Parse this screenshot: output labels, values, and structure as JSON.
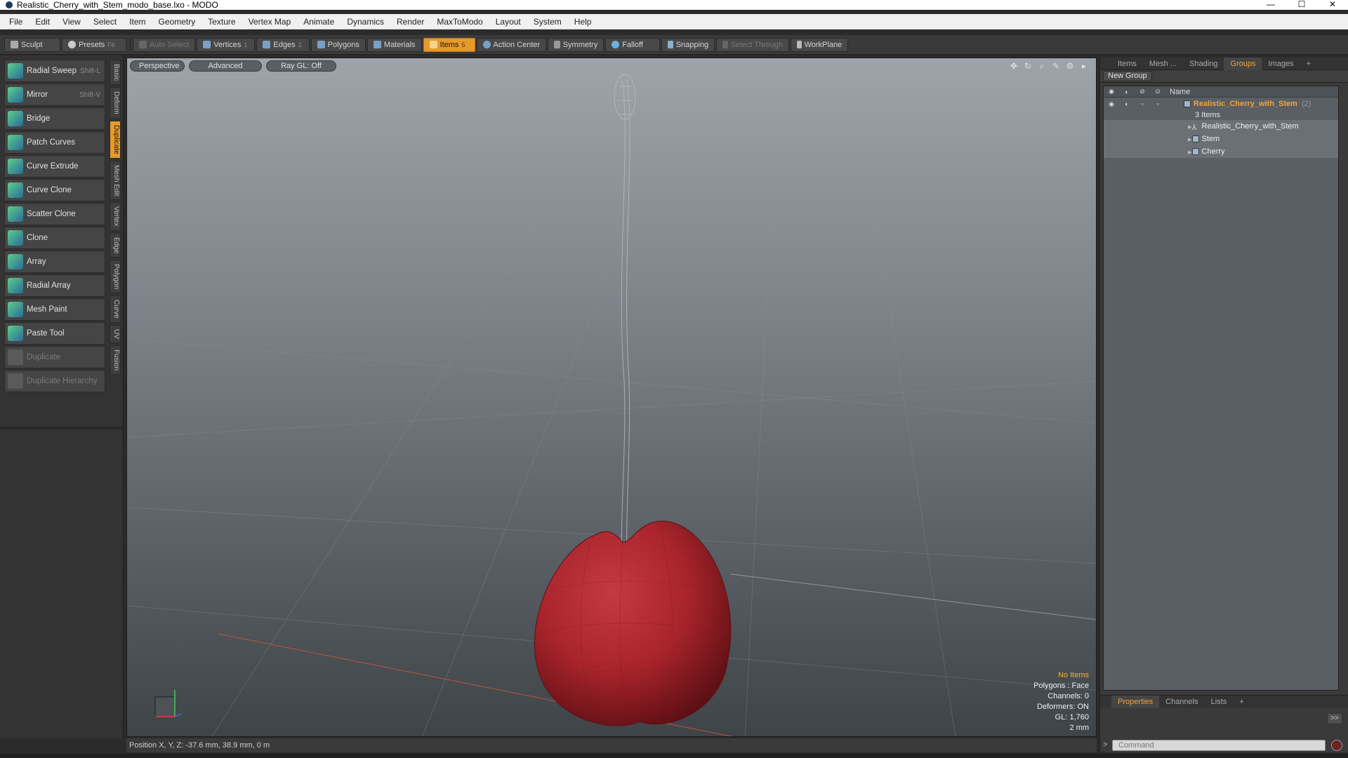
{
  "window": {
    "title": "Realistic_Cherry_with_Stem_modo_base.lxo - MODO",
    "controls": [
      "—",
      "☐",
      "✕"
    ]
  },
  "menu": [
    "File",
    "Edit",
    "View",
    "Select",
    "Item",
    "Geometry",
    "Texture",
    "Vertex Map",
    "Animate",
    "Dynamics",
    "Render",
    "MaxToModo",
    "Layout",
    "System",
    "Help"
  ],
  "toolbar": {
    "sculpt": "Sculpt",
    "presets": "Presets",
    "presets_key": "F6",
    "auto_select": "Auto Select",
    "vertices": "Vertices",
    "vertices_num": "1",
    "edges": "Edges",
    "edges_num": "2",
    "polygons": "Polygons",
    "materials": "Materials",
    "items": "Items",
    "items_num": "5",
    "action_center": "Action Center",
    "symmetry": "Symmetry",
    "falloff": "Falloff",
    "snapping": "Snapping",
    "select_through": "Select Through",
    "workplane": "WorkPlane"
  },
  "tools": [
    {
      "label": "Radial Sweep",
      "key": "Shift-L",
      "enabled": true
    },
    {
      "label": "Mirror",
      "key": "Shift-V",
      "enabled": true
    },
    {
      "label": "Bridge",
      "key": "",
      "enabled": true
    },
    {
      "label": "Patch Curves",
      "key": "",
      "enabled": true
    },
    {
      "label": "Curve Extrude",
      "key": "",
      "enabled": true
    },
    {
      "label": "Curve Clone",
      "key": "",
      "enabled": true
    },
    {
      "label": "Scatter Clone",
      "key": "",
      "enabled": true
    },
    {
      "label": "Clone",
      "key": "",
      "enabled": true
    },
    {
      "label": "Array",
      "key": "",
      "enabled": true
    },
    {
      "label": "Radial Array",
      "key": "",
      "enabled": true
    },
    {
      "label": "Mesh Paint",
      "key": "",
      "enabled": true
    },
    {
      "label": "Paste Tool",
      "key": "",
      "enabled": true
    },
    {
      "label": "Duplicate",
      "key": "",
      "enabled": false
    },
    {
      "label": "Duplicate Hierarchy",
      "key": "",
      "enabled": false
    }
  ],
  "vtabs": [
    {
      "label": "Basic",
      "active": false
    },
    {
      "label": "Deform",
      "active": false
    },
    {
      "label": "Duplicate",
      "active": true
    },
    {
      "label": "Mesh Edit",
      "active": false
    },
    {
      "label": "Vertex",
      "active": false
    },
    {
      "label": "Edge",
      "active": false
    },
    {
      "label": "Polygon",
      "active": false
    },
    {
      "label": "Curve",
      "active": false
    },
    {
      "label": "UV",
      "active": false
    },
    {
      "label": "Fusion",
      "active": false
    }
  ],
  "viewport": {
    "view": "Perspective",
    "shading": "Advanced",
    "raygl": "Ray GL: Off",
    "status": {
      "no_items": "No Items",
      "polygons": "Polygons : Face",
      "channels": "Channels: 0",
      "deformers": "Deformers: ON",
      "gl": "GL: 1,760",
      "scale": "2 mm"
    }
  },
  "statusbar": {
    "text": "Position X, Y, Z:  -37.6 mm, 38.9 mm, 0 m"
  },
  "rightpanel": {
    "tabs": [
      {
        "label": "Items",
        "active": false
      },
      {
        "label": "Mesh ...",
        "active": false
      },
      {
        "label": "Shading",
        "active": false
      },
      {
        "label": "Groups",
        "active": true
      },
      {
        "label": "Images",
        "active": false
      },
      {
        "label": "+",
        "active": false
      }
    ],
    "new_group": "New Group",
    "col_name": "Name",
    "group": {
      "name": "Realistic_Cherry_with_Stem",
      "count": "(2)",
      "items_label": "3 Items"
    },
    "children": [
      "Realistic_Cherry_with_Stem",
      "Stem",
      "Cherry"
    ],
    "bottom_tabs": [
      {
        "label": "Properties",
        "active": true
      },
      {
        "label": "Channels",
        "active": false
      },
      {
        "label": "Lists",
        "active": false
      },
      {
        "label": "+",
        "active": false
      }
    ],
    "expand": ">>"
  },
  "command": {
    "placeholder": "Command",
    "prompt": ">"
  },
  "colors": {
    "accent": "#e69a2a",
    "cherry": "#a8242b",
    "viewport_top": "#9ea4a9",
    "viewport_bottom": "#3f4448"
  }
}
